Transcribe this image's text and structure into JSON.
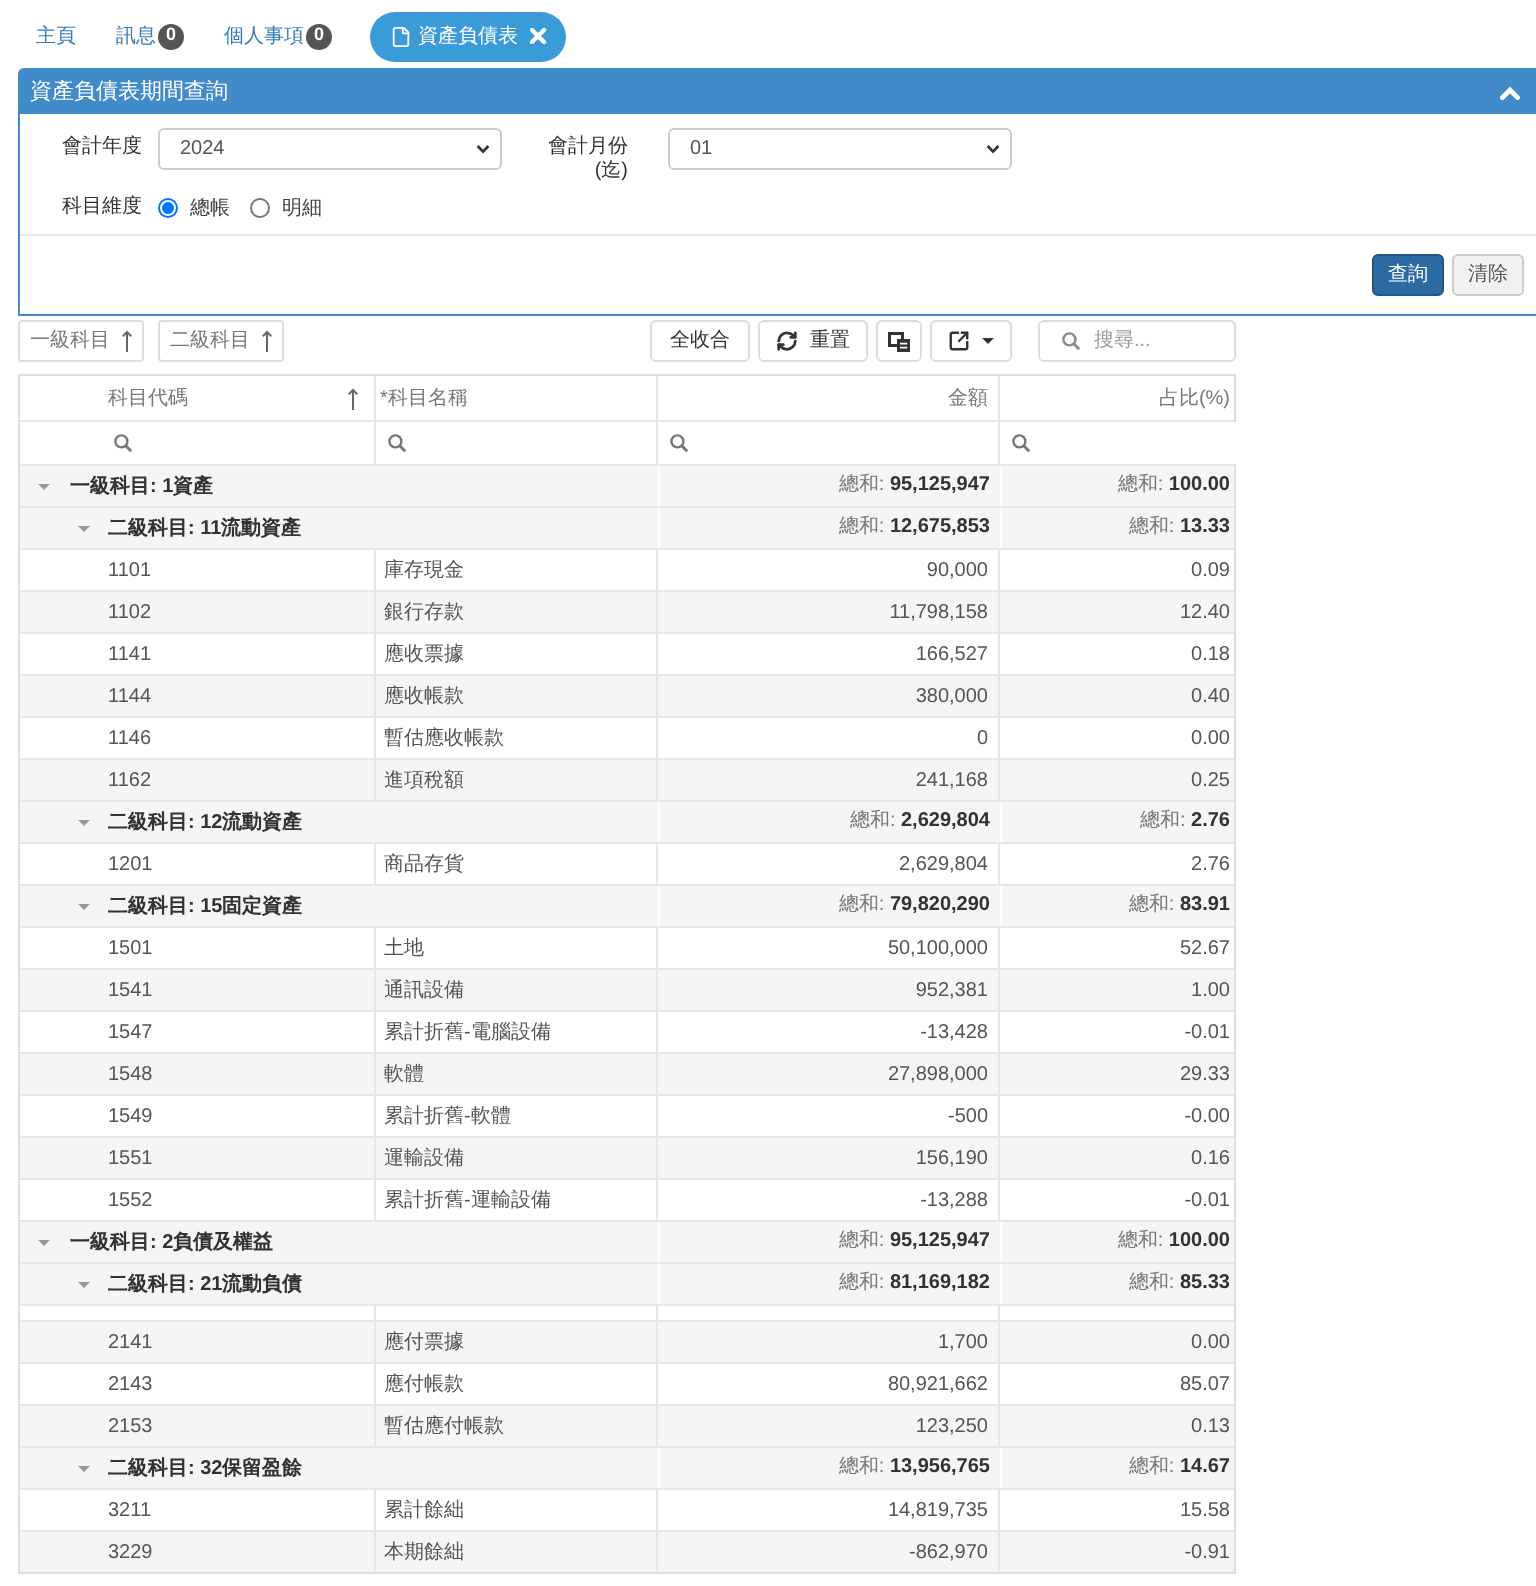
{
  "tabs": [
    {
      "label": "主頁",
      "selected": false
    },
    {
      "label": "訊息",
      "badge": "0",
      "selected": false
    },
    {
      "label": "個人事項",
      "badge": "0",
      "selected": false
    },
    {
      "label": "資產負債表",
      "selected": true,
      "closable": true
    }
  ],
  "query_panel": {
    "title": "資產負債表期間查詢",
    "expanded": true,
    "fields": [
      {
        "label": "會計年度",
        "value": "2024"
      },
      {
        "label": "會計月份 (迄)",
        "value": "01"
      }
    ],
    "dimension": {
      "label": "科目維度",
      "options": [
        {
          "label": "總帳",
          "selected": true
        },
        {
          "label": "明細",
          "selected": false
        }
      ]
    },
    "buttons": [
      {
        "label": "查詢",
        "kind": "primary"
      },
      {
        "label": "清除",
        "kind": "default"
      }
    ]
  },
  "toolbar": {
    "group_chips": [
      {
        "label": "一級科目",
        "sorted": true
      },
      {
        "label": "二級科目",
        "sorted": true
      }
    ],
    "buttons": [
      {
        "kind": "text",
        "label": "全收合"
      },
      {
        "kind": "refresh",
        "label": "重置"
      },
      {
        "kind": "copy"
      },
      {
        "kind": "export"
      }
    ],
    "search": {
      "placeholder": "搜尋..."
    }
  },
  "table": {
    "columns": [
      {
        "label": "科目代碼",
        "sorted": true
      },
      {
        "label": "*科目名稱",
        "sorted": false
      },
      {
        "label": "金額",
        "sorted": false
      },
      {
        "label": "占比(%)",
        "sorted": false
      }
    ],
    "groups": [
      {
        "label": "一級科目: 1資產",
        "expanded": true,
        "amount": "總和: **95,125,947**",
        "ratio": "總和: **100.00**",
        "children": [
          {
            "label": "二級科目: 11流動資產",
            "expanded": true,
            "amount": "總和: **12,675,853**",
            "ratio": "總和: **13.33**",
            "rows": [
              {
                "kind": "account",
                "code": "1101",
                "name": "庫存現金",
                "amount": "90,000",
                "ratio": "0.09"
              },
              {
                "kind": "account",
                "code": "1102",
                "name": "銀行存款",
                "amount": "11,798,158",
                "ratio": "12.40"
              },
              {
                "kind": "account",
                "code": "1141",
                "name": "應收票據",
                "amount": "166,527",
                "ratio": "0.18"
              },
              {
                "kind": "account",
                "code": "1144",
                "name": "應收帳款",
                "amount": "380,000",
                "ratio": "0.40"
              },
              {
                "kind": "account",
                "code": "1146",
                "name": "暫估應收帳款",
                "amount": "0",
                "ratio": "0.00"
              },
              {
                "kind": "account",
                "code": "1162",
                "name": "進項稅額",
                "amount": "241,168",
                "ratio": "0.25"
              }
            ]
          },
          {
            "label": "二級科目: 12流動資產",
            "expanded": true,
            "amount": "總和: **2,629,804**",
            "ratio": "總和: **2.76**",
            "rows": [
              {
                "kind": "account",
                "code": "1201",
                "name": "商品存貨",
                "amount": "2,629,804",
                "ratio": "2.76"
              }
            ]
          },
          {
            "label": "二級科目: 15固定資產",
            "expanded": true,
            "amount": "總和: **79,820,290**",
            "ratio": "總和: **83.91**",
            "rows": [
              {
                "kind": "account",
                "code": "1501",
                "name": "土地",
                "amount": "50,100,000",
                "ratio": "52.67"
              },
              {
                "kind": "account",
                "code": "1541",
                "name": "通訊設備",
                "amount": "952,381",
                "ratio": "1.00"
              },
              {
                "kind": "account",
                "code": "1547",
                "name": "累計折舊-電腦設備",
                "amount": "-13,428",
                "ratio": "-0.01"
              },
              {
                "kind": "account",
                "code": "1548",
                "name": "軟體",
                "amount": "27,898,000",
                "ratio": "29.33"
              },
              {
                "kind": "account",
                "code": "1549",
                "name": "累計折舊-軟體",
                "amount": "-500",
                "ratio": "-0.00"
              },
              {
                "kind": "account",
                "code": "1551",
                "name": "運輸設備",
                "amount": "156,190",
                "ratio": "0.16"
              },
              {
                "kind": "account",
                "code": "1552",
                "name": "累計折舊-運輸設備",
                "amount": "-13,288",
                "ratio": "-0.01"
              }
            ]
          }
        ]
      },
      {
        "label": "一級科目: 2負債及權益",
        "expanded": true,
        "amount": "總和: **95,125,947**",
        "ratio": "總和: **100.00**",
        "children": [
          {
            "label": "二級科目: 21流動負債",
            "expanded": true,
            "amount": "總和: **81,169,182**",
            "ratio": "總和: **85.33**",
            "rows": [
              {
                "kind": "blank"
              },
              {
                "kind": "account",
                "code": "2141",
                "name": "應付票據",
                "amount": "1,700",
                "ratio": "0.00"
              },
              {
                "kind": "account",
                "code": "2143",
                "name": "應付帳款",
                "amount": "80,921,662",
                "ratio": "85.07"
              },
              {
                "kind": "account",
                "code": "2153",
                "name": "暫估應付帳款",
                "amount": "123,250",
                "ratio": "0.13"
              }
            ]
          },
          {
            "label": "二級科目: 32保留盈餘",
            "expanded": true,
            "amount": "總和: **13,956,765**",
            "ratio": "總和: **14.67**",
            "rows": [
              {
                "kind": "account",
                "code": "3211",
                "name": "累計餘絀",
                "amount": "14,819,735",
                "ratio": "15.58"
              },
              {
                "kind": "account",
                "code": "3229",
                "name": "本期餘絀",
                "amount": "-862,970",
                "ratio": "-0.91"
              }
            ]
          }
        ]
      }
    ]
  }
}
